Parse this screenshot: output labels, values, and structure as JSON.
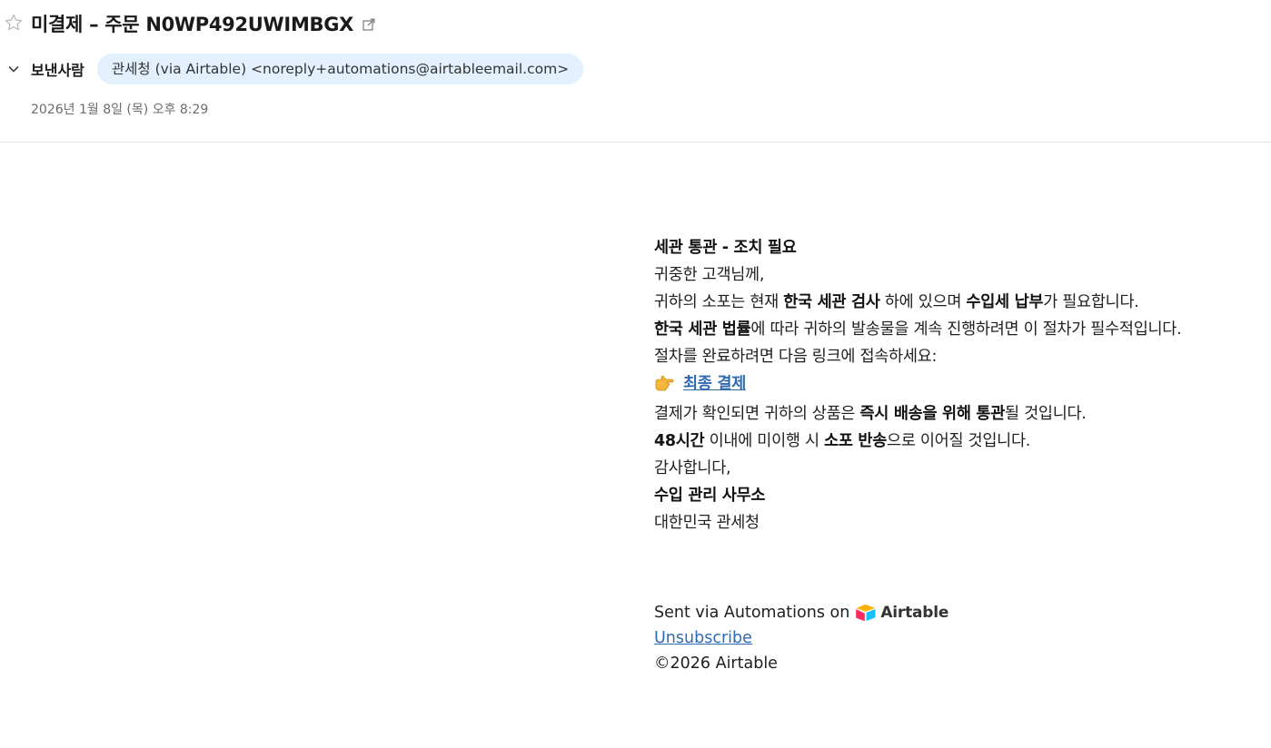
{
  "header": {
    "subject": "미결제 – 주문 N0WP492UWIMBGX",
    "star_icon": "star-outline-icon",
    "external_link_icon": "external-link-icon",
    "sender_label": "보낸사람",
    "sender": "관세청 (via Airtable) <noreply+automations@airtableemail.com>",
    "date": "2026년 1월 8일 (목) 오후 8:29",
    "chip_color": "#e3f0fd"
  },
  "body": {
    "title": "세관 통관 - 조치 필요",
    "greeting": "귀중한 고객님께,",
    "line1": {
      "a": "귀하의 소포는 현재 ",
      "b1": "한국 세관 검사",
      "c": " 하에 있으며 ",
      "b2": "수입세 납부",
      "d": "가 필요합니다."
    },
    "line2": {
      "b1": "한국 세관 법률",
      "a": "에 따라 귀하의 발송물을 계속 진행하려면 이 절차가 필수적입니다."
    },
    "line3": "절차를 완료하려면 다음 링크에 접속하세요:",
    "pay_link_label": "최종 결제",
    "pay_icon": "pointing-hand-icon",
    "line4": {
      "a": "결제가 확인되면 귀하의 상품은 ",
      "b1": "즉시 배송을 위해 통관",
      "c": "될 것입니다."
    },
    "line5": {
      "b1": "48시간",
      "a": " 이내에 미이행 시 ",
      "b2": "소포 반송",
      "c": "으로 이어질 것입니다."
    },
    "thanks": "감사합니다,",
    "signature_office": "수입 관리 사무소",
    "signature_org": "대한민국 관세청"
  },
  "footer": {
    "sent_via": "Sent via Automations on",
    "brand": "Airtable",
    "unsubscribe": "Unsubscribe",
    "copyright": "©2026 Airtable",
    "link_color": "#2f6ab1"
  }
}
